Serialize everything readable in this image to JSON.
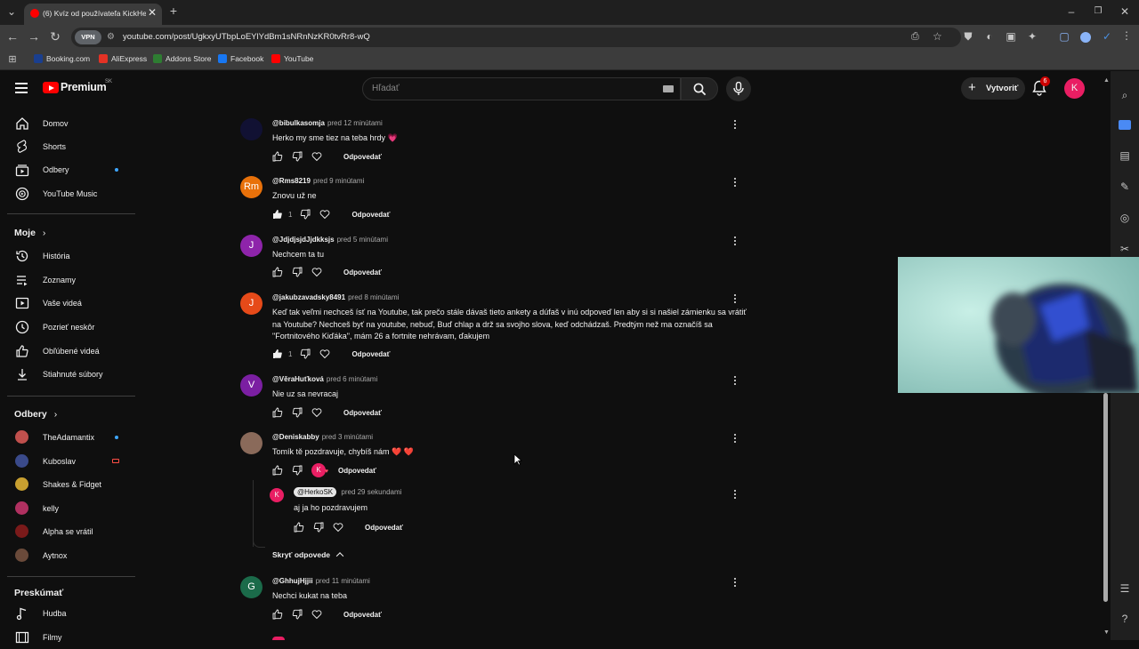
{
  "browser": {
    "tab_title": "(6) Kvíz od používateľa KickHe",
    "url": "youtube.com/post/UgkxyUTbpLoEYlYdBm1sNRnNzKR0tvRr8-wQ",
    "vpn_label": "VPN",
    "bookmarks": [
      {
        "label": "Booking.com",
        "color": "#1a3f8f"
      },
      {
        "label": "AliExpress",
        "color": "#e43225"
      },
      {
        "label": "Addons Store",
        "color": "#2e7d32"
      },
      {
        "label": "Facebook",
        "color": "#1877f2"
      },
      {
        "label": "YouTube",
        "color": "#ff0000"
      }
    ]
  },
  "header": {
    "logo_text": "Premium",
    "logo_region": "SK",
    "search_placeholder": "Hľadať",
    "create_label": "Vytvoriť",
    "notification_count": "6",
    "avatar_letter": "K"
  },
  "sidebar": {
    "main": [
      {
        "label": "Domov",
        "icon": "home-icon"
      },
      {
        "label": "Shorts",
        "icon": "shorts-icon"
      },
      {
        "label": "Odbery",
        "icon": "subscriptions-icon"
      },
      {
        "label": "YouTube Music",
        "icon": "music-icon"
      }
    ],
    "you_heading": "Moje",
    "you": [
      {
        "label": "História",
        "icon": "history-icon"
      },
      {
        "label": "Zoznamy",
        "icon": "playlists-icon"
      },
      {
        "label": "Vaše videá",
        "icon": "your-videos-icon"
      },
      {
        "label": "Pozrieť neskôr",
        "icon": "watch-later-icon"
      },
      {
        "label": "Obľúbené videá",
        "icon": "liked-icon"
      },
      {
        "label": "Stiahnuté súbory",
        "icon": "download-icon"
      }
    ],
    "subs_heading": "Odbery",
    "subs": [
      {
        "label": "TheAdamantix",
        "color": "#c0504d"
      },
      {
        "label": "Kuboslav",
        "color": "#3a4a8a"
      },
      {
        "label": "Shakes & Fidget",
        "color": "#c8a030"
      },
      {
        "label": "kelly",
        "color": "#b03060"
      },
      {
        "label": "Alpha se vrátil",
        "color": "#7a1a1a"
      },
      {
        "label": "Aytnox",
        "color": "#6a4a3a"
      }
    ],
    "explore_heading": "Preskúmať",
    "explore": [
      {
        "label": "Hudba",
        "icon": "music-note-icon"
      },
      {
        "label": "Filmy",
        "icon": "film-icon"
      }
    ]
  },
  "comments": [
    {
      "author": "@bibulkasomja",
      "time": "pred 12 minútami",
      "text": "Herko my sme tiez na teba hrdy 💗",
      "likes": "",
      "avatar": "",
      "avatar_color": "#111133"
    },
    {
      "author": "@Rms8219",
      "time": "pred 9 minútami",
      "text": "Znovu už ne",
      "likes": "1",
      "avatar": "Rm",
      "avatar_color": "#e8710a"
    },
    {
      "author": "@JdjdjsjdJjdkksjs",
      "time": "pred 5 minútami",
      "text": "Nechcem ta tu",
      "likes": "",
      "avatar": "J",
      "avatar_color": "#8e24aa"
    },
    {
      "author": "@jakubzavadsky8491",
      "time": "pred 8 minútami",
      "text": "Keď tak veľmi nechceš ísť na Youtube, tak prečo stále dávaš tieto ankety a dúfaš v inú odpoveď len aby si si našiel zámienku sa vrátiť na Youtube?  Nechceš byť na youtube, nebuď, Buď chlap a drž sa svojho slova, keď odchádzaš. Predtým než ma označíš sa \"Fortnitového Kiďáka\", mám 26 a fortnite nehrávam, ďakujem",
      "likes": "1",
      "avatar": "J",
      "avatar_color": "#e64a19"
    },
    {
      "author": "@VěraHuťková",
      "time": "pred 6 minútami",
      "text": "Nie uz sa nevracaj",
      "likes": "",
      "avatar": "V",
      "avatar_color": "#7b1fa2"
    },
    {
      "author": "@Deniskabby",
      "time": "pred 3 minútami",
      "text": "Tomík tě pozdravuje, chybíš nám ❤️ ❤️",
      "likes": "",
      "avatar": "",
      "avatar_color": "#8a6a5a"
    },
    {
      "author": "@GhhujHjjii",
      "time": "pred 11 minútami",
      "text": "Nechci kukat na teba",
      "likes": "",
      "avatar": "G",
      "avatar_color": "#1b6b4a"
    }
  ],
  "reply": {
    "author": "@HerkoSK",
    "time": "pred 29 sekundami",
    "text": "aj ja ho pozdravujem",
    "avatar": "K"
  },
  "reply_label": "Odpovedať",
  "hide_replies_label": "Skryť odpovede"
}
